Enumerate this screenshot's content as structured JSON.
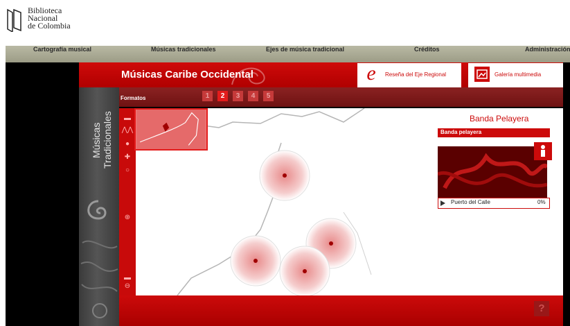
{
  "header": {
    "logo_line1": "Biblioteca",
    "logo_line2": "Nacional",
    "logo_line3": "de Colombia"
  },
  "nav": {
    "items": [
      "Cartografía musical",
      "Músicas tradicionales",
      "Ejes de música tradicional",
      "Créditos",
      "Administración"
    ]
  },
  "app": {
    "title": "Músicas Caribe Occidental",
    "resena_label": "Reseña del Eje Regional",
    "galeria_label": "Galería multimedia",
    "formatos_label": "Formatos",
    "format_pages": [
      "1",
      "2",
      "3",
      "4",
      "5"
    ],
    "active_format": "2",
    "sidebar_line1": "Músicas",
    "sidebar_line2": "Tradicionales"
  },
  "panel": {
    "title": "Banda Pelayera",
    "subtitle": "Banda pelayera",
    "track_name": "Puerto del Calle",
    "progress": "0%"
  },
  "colors": {
    "primary_red": "#cc0a0a",
    "dark_red": "#6f1212",
    "nav_olive": "#a9a993"
  },
  "icons": {
    "resena": "e-letter-icon",
    "galeria": "gallery-icon",
    "info": "info-icon",
    "help": "help-icon",
    "play": "play-icon"
  }
}
